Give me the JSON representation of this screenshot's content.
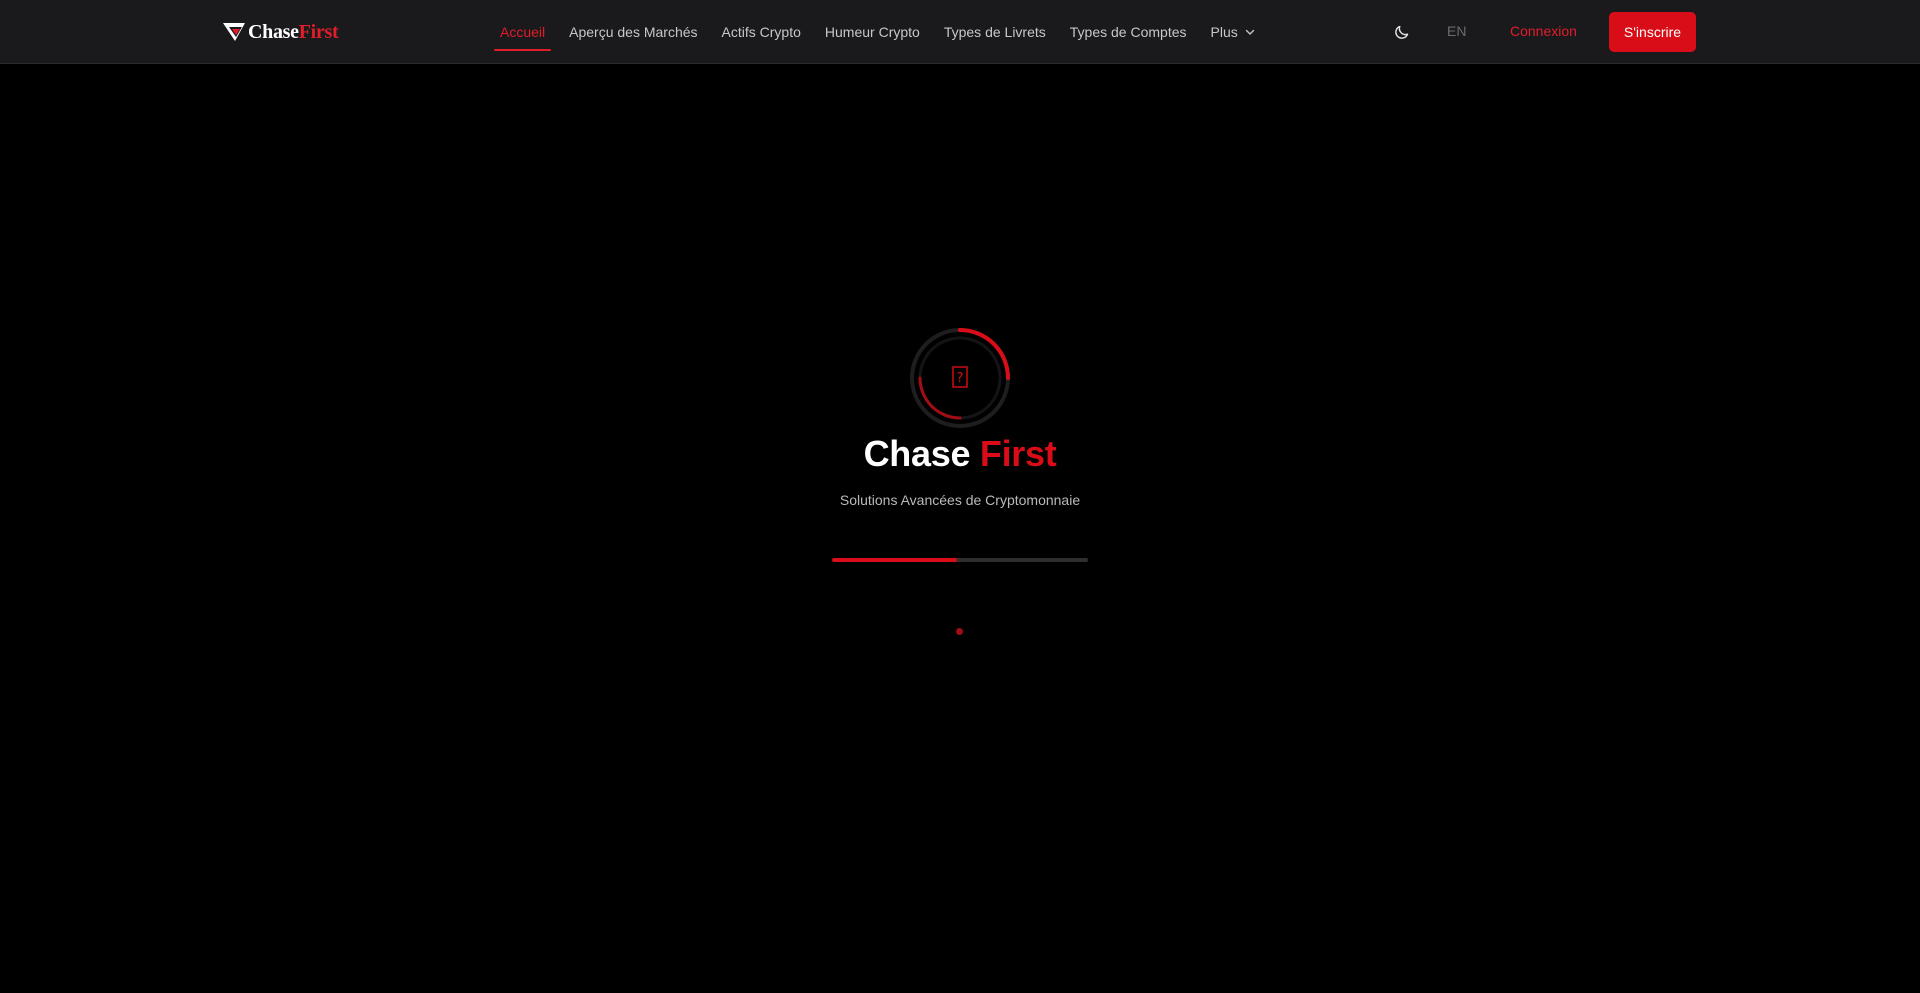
{
  "brand": {
    "part1": "Chase",
    "part2": "First"
  },
  "nav": {
    "items": [
      {
        "label": "Accueil",
        "active": true
      },
      {
        "label": "Aperçu des Marchés",
        "active": false
      },
      {
        "label": "Actifs Crypto",
        "active": false
      },
      {
        "label": "Humeur Crypto",
        "active": false
      },
      {
        "label": "Types de Livrets",
        "active": false
      },
      {
        "label": "Types de Comptes",
        "active": false
      },
      {
        "label": "Plus",
        "active": false,
        "dropdown": true
      }
    ]
  },
  "header_actions": {
    "theme_icon": "moon-icon",
    "language": "EN",
    "login_label": "Connexion",
    "signup_label": "S'inscrire"
  },
  "loader": {
    "title_part1": "Chase",
    "title_part2": "First",
    "tagline": "Solutions Avancées de Cryptomonnaie",
    "progress": 0.49,
    "glyph": "?"
  },
  "colors": {
    "accent": "#e11d2a",
    "button": "#d90d17",
    "navbar_bg": "#1a1a1d",
    "page_bg": "#000000"
  }
}
